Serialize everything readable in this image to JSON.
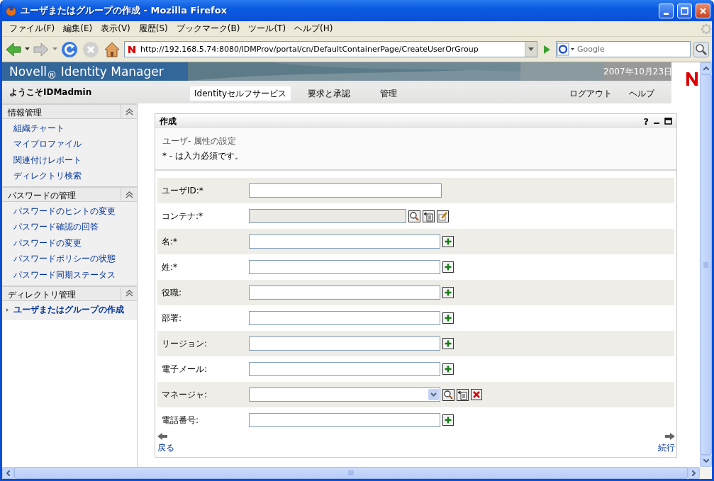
{
  "window": {
    "title": "ユーザまたはグループの作成 - Mozilla Firefox"
  },
  "menu": [
    "ファイル(F)",
    "編集(E)",
    "表示(V)",
    "履歴(S)",
    "ブックマーク(B)",
    "ツール(T)",
    "ヘルプ(H)"
  ],
  "address": {
    "value": "http://192.168.5.74:8080/IDMProv/portal/cn/DefaultContainerPage/CreateUserOrGroup"
  },
  "search": {
    "placeholder": "Google"
  },
  "header": {
    "brand": "Novell$_{®}$ Identity Manager",
    "date": "2007年10月23日",
    "welcome": "ようこそIDMadmin"
  },
  "tabs": [
    {
      "label": "Identityセルフサービス",
      "selected": true
    },
    {
      "label": "要求と承認",
      "selected": false
    },
    {
      "label": "管理",
      "selected": false
    }
  ],
  "header_links": [
    "ログアウト",
    "ヘルプ"
  ],
  "sidebar": [
    {
      "title": "情報管理",
      "expanded": true,
      "items": [
        {
          "label": "組織チャート",
          "selected": false
        },
        {
          "label": "マイプロファイル",
          "selected": false
        },
        {
          "label": "関連付けレポート",
          "selected": false
        },
        {
          "label": "ディレクトリ検索",
          "selected": false
        }
      ]
    },
    {
      "title": "パスワードの管理",
      "expanded": true,
      "items": [
        {
          "label": "パスワードのヒントの変更",
          "selected": false
        },
        {
          "label": "パスワード確認の回答",
          "selected": false
        },
        {
          "label": "パスワードの変更",
          "selected": false
        },
        {
          "label": "パスワードポリシーの状態",
          "selected": false
        },
        {
          "label": "パスワード同期ステータス",
          "selected": false
        }
      ]
    },
    {
      "title": "ディレクトリ管理",
      "expanded": true,
      "items": [
        {
          "label": "ユーザまたはグループの作成",
          "selected": true
        }
      ]
    }
  ],
  "panel": {
    "title": "作成",
    "help": "?",
    "heading": "ユーザ- 属性の設定",
    "note": "* - は入力必須です。",
    "fields": [
      {
        "label": "ユーザID:*",
        "kind": "text",
        "disabled": false
      },
      {
        "label": "コンテナ:*",
        "kind": "container",
        "disabled": true
      },
      {
        "label": "名:*",
        "kind": "add",
        "disabled": false
      },
      {
        "label": "姓:*",
        "kind": "add",
        "disabled": false
      },
      {
        "label": "役職:",
        "kind": "add",
        "disabled": false
      },
      {
        "label": "部署:",
        "kind": "add",
        "disabled": false
      },
      {
        "label": "リージョン:",
        "kind": "add",
        "disabled": false
      },
      {
        "label": "電子メール:",
        "kind": "add",
        "disabled": false
      },
      {
        "label": "マネージャ:",
        "kind": "select",
        "disabled": false
      },
      {
        "label": "電話番号:",
        "kind": "add",
        "disabled": false
      }
    ],
    "back": "戻る",
    "next": "続行"
  }
}
